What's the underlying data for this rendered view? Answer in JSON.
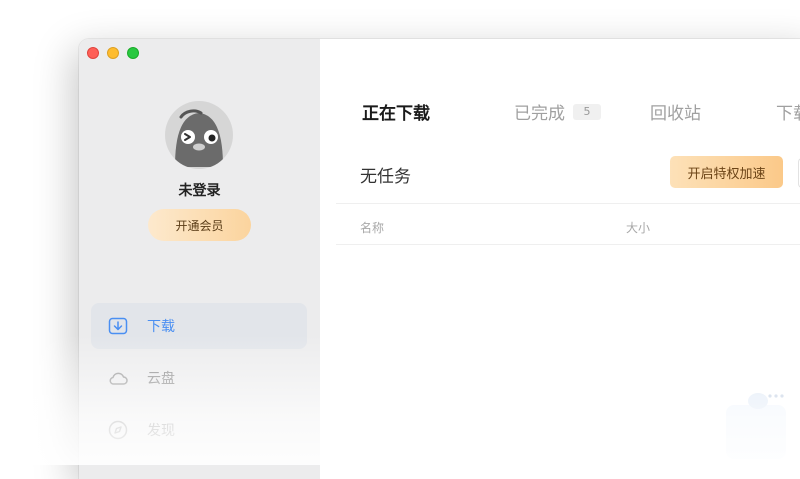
{
  "sidebar": {
    "user": {
      "name": "未登录"
    },
    "vip_button": "开通会员",
    "nav": [
      {
        "label": "下载",
        "icon": "download-icon",
        "active": true
      },
      {
        "label": "云盘",
        "icon": "cloud-icon",
        "active": false
      },
      {
        "label": "发现",
        "icon": "compass-icon",
        "active": false
      }
    ]
  },
  "main": {
    "tabs": [
      {
        "label": "正在下载",
        "active": true
      },
      {
        "label": "已完成",
        "badge": "5",
        "active": false
      },
      {
        "label": "回收站",
        "active": false
      },
      {
        "label": "下载",
        "active": false
      }
    ],
    "section_title": "无任务",
    "accelerate_button": "开启特权加速",
    "columns": {
      "name": "名称",
      "size": "大小"
    }
  },
  "colors": {
    "accent_blue": "#4a8ff2",
    "vip_gold": "#fbc989",
    "sidebar_bg": "#ececed"
  }
}
